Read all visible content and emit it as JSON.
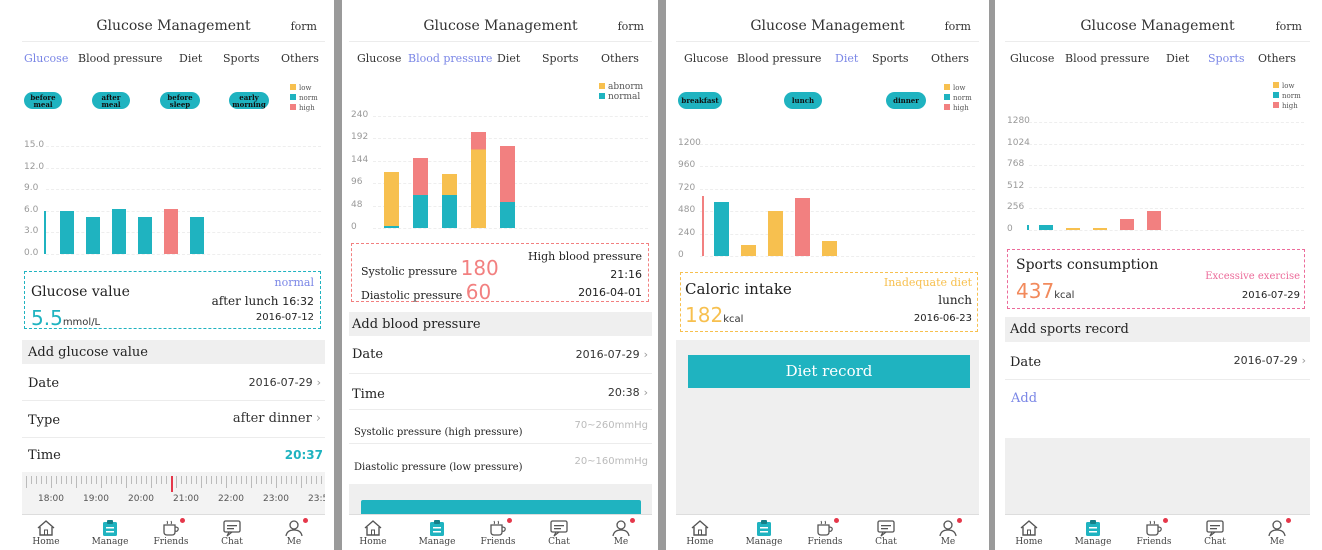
{
  "app": {
    "title": "Glucose Management",
    "form_label": "form"
  },
  "tabs": [
    "Glucose",
    "Blood pressure",
    "Diet",
    "Sports",
    "Others"
  ],
  "colors": {
    "accent": "#1fb3c0",
    "tab_active": "#7a86e6",
    "low": "#f7c04f",
    "normal": "#1fb3c0",
    "high": "#f28080",
    "alert_pink": "#ec6b9a",
    "alert_orange": "#f28a5c"
  },
  "nav": [
    {
      "label": "Home",
      "icon": "home-icon",
      "badge": false
    },
    {
      "label": "Manage",
      "icon": "clipboard-icon",
      "badge": false
    },
    {
      "label": "Friends",
      "icon": "cup-icon",
      "badge": true
    },
    {
      "label": "Chat",
      "icon": "chat-icon",
      "badge": false
    },
    {
      "label": "Me",
      "icon": "person-icon",
      "badge": true
    }
  ],
  "glucose": {
    "pills": [
      "before meal",
      "after meal",
      "before sleep",
      "early morning"
    ],
    "legend": [
      "low",
      "norm",
      "high"
    ],
    "chart_data": {
      "type": "bar",
      "yticks": [
        "15.0",
        "12.0",
        "9.0",
        "6.0",
        "3.0",
        "0.0"
      ],
      "ylim": [
        0,
        15
      ],
      "values": [
        6.0,
        5.1,
        6.3,
        5.1,
        6.3,
        5.1
      ],
      "colors": [
        "#1fb3c0",
        "#1fb3c0",
        "#1fb3c0",
        "#1fb3c0",
        "#f28080",
        "#1fb3c0"
      ]
    },
    "card": {
      "title": "Glucose value",
      "status": "normal",
      "meal": "after lunch",
      "time": "16:32",
      "value": "5.5",
      "unit": "mmol/L",
      "date": "2016-07-12"
    },
    "add_header": "Add glucose value",
    "rows": [
      {
        "label": "Date",
        "value": "2016-07-29"
      },
      {
        "label": "Type",
        "value": "after dinner"
      }
    ],
    "time_label": "Time",
    "time_value": "20:37",
    "ruler": [
      "18:00",
      "19:00",
      "20:00",
      "21:00",
      "22:00",
      "23:00",
      "23:5"
    ]
  },
  "bp": {
    "legend": [
      "abnorm",
      "normal"
    ],
    "chart_data": {
      "type": "bar",
      "yticks": [
        "240",
        "192",
        "144",
        "96",
        "48",
        "0"
      ],
      "ylim": [
        0,
        240
      ],
      "stacks": [
        {
          "normal": 5,
          "abnormal": 115
        },
        {
          "normal": 70,
          "abnormal": 80
        },
        {
          "normal": 70,
          "abnormal": 45
        },
        {
          "normal": 0,
          "abnormal": 205
        },
        {
          "normal": 55,
          "abnormal": 120
        }
      ]
    },
    "card": {
      "systolic_label": "Systolic pressure",
      "systolic": "180",
      "diastolic_label": "Diastolic pressure",
      "diastolic": "60",
      "status": "High blood pressure",
      "time": "21:16",
      "date": "2016-04-01"
    },
    "add_header": "Add blood pressure",
    "rows": [
      {
        "label": "Date",
        "value": "2016-07-29"
      },
      {
        "label": "Time",
        "value": "20:38"
      }
    ],
    "inputs": [
      {
        "label": "Systolic pressure (high pressure)",
        "placeholder": "70~260mmHg"
      },
      {
        "label": "Diastolic pressure (low pressure)",
        "placeholder": "20~160mmHg"
      }
    ]
  },
  "diet": {
    "pills": [
      "breakfast",
      "lunch",
      "dinner"
    ],
    "legend": [
      "low",
      "norm",
      "high"
    ],
    "chart_data": {
      "type": "bar",
      "yticks": [
        "1200",
        "960",
        "720",
        "480",
        "240",
        "0"
      ],
      "ylim": [
        0,
        1200
      ],
      "values": [
        580,
        120,
        480,
        620,
        160
      ],
      "colors": [
        "#1fb3c0",
        "#f7c04f",
        "#f7c04f",
        "#f28080",
        "#f7c04f"
      ]
    },
    "card": {
      "title": "Caloric intake",
      "status": "Inadequate diet",
      "meal": "lunch",
      "value": "182",
      "unit": "kcal",
      "date": "2016-06-23"
    },
    "button": "Diet record"
  },
  "sports": {
    "legend": [
      "low",
      "norm",
      "high"
    ],
    "chart_data": {
      "type": "bar",
      "yticks": [
        "1280",
        "1024",
        "768",
        "512",
        "256",
        "0"
      ],
      "ylim": [
        0,
        1280
      ],
      "values": [
        60,
        15,
        15,
        130,
        230
      ],
      "colors": [
        "#1fb3c0",
        "#f7c04f",
        "#f7c04f",
        "#f28080",
        "#f28080"
      ]
    },
    "card": {
      "title": "Sports consumption",
      "status": "Excessive exercise",
      "value": "437",
      "unit": "kcal",
      "date": "2016-07-29"
    },
    "add_header": "Add sports record",
    "rows": [
      {
        "label": "Date",
        "value": "2016-07-29"
      }
    ],
    "add_link": "Add"
  }
}
